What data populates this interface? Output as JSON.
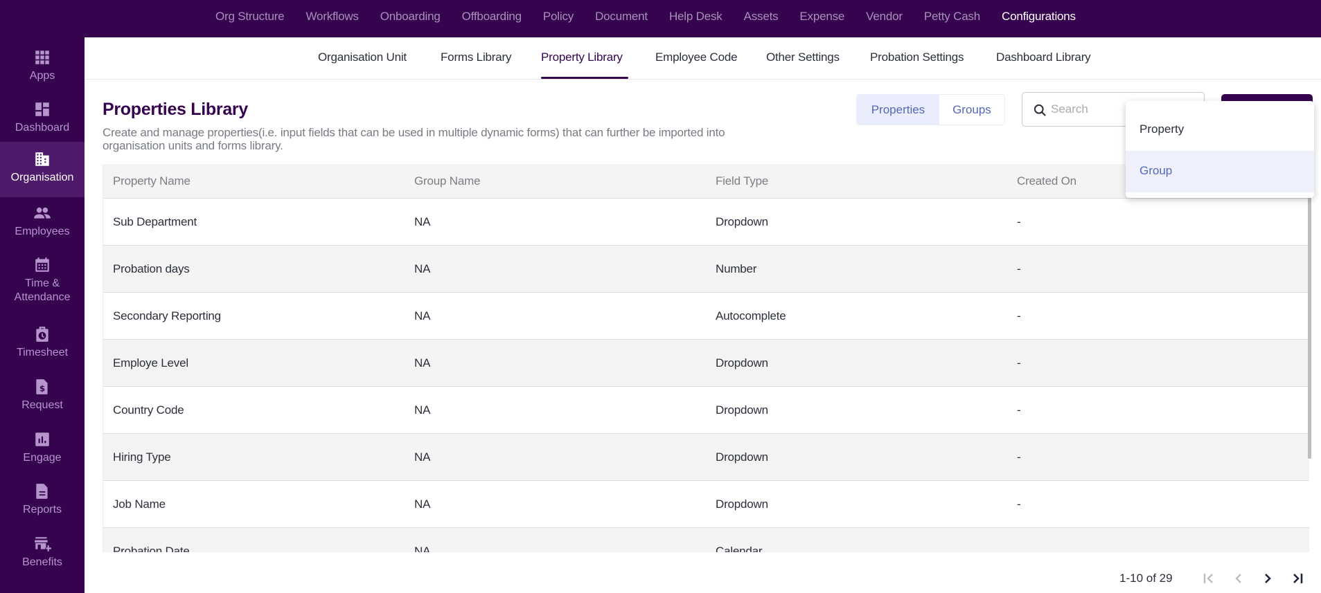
{
  "topnav": {
    "items": [
      {
        "label": "Org Structure",
        "active": false
      },
      {
        "label": "Workflows",
        "active": false
      },
      {
        "label": "Onboarding",
        "active": false
      },
      {
        "label": "Offboarding",
        "active": false
      },
      {
        "label": "Policy",
        "active": false
      },
      {
        "label": "Document",
        "active": false
      },
      {
        "label": "Help Desk",
        "active": false
      },
      {
        "label": "Assets",
        "active": false
      },
      {
        "label": "Expense",
        "active": false
      },
      {
        "label": "Vendor",
        "active": false
      },
      {
        "label": "Petty Cash",
        "active": false
      },
      {
        "label": "Configurations",
        "active": true
      }
    ]
  },
  "sidebar": {
    "items": [
      {
        "label": "Apps",
        "icon": "apps-grid-icon"
      },
      {
        "label": "Dashboard",
        "icon": "dashboard-icon"
      },
      {
        "label": "Organisation",
        "icon": "building-icon",
        "active": true
      },
      {
        "label": "Employees",
        "icon": "people-icon"
      },
      {
        "label": "Time &",
        "label2": "Attendance",
        "icon": "calendar-icon"
      },
      {
        "label": "Timesheet",
        "icon": "timesheet-clock-icon"
      },
      {
        "label": "Request",
        "icon": "dollar-document-icon"
      },
      {
        "label": "Engage",
        "icon": "bar-chart-icon"
      },
      {
        "label": "Reports",
        "icon": "report-document-icon"
      },
      {
        "label": "Benefits",
        "icon": "store-plus-icon"
      }
    ]
  },
  "subnav": {
    "items": [
      {
        "label": "Organisation Unit"
      },
      {
        "label": "Forms Library"
      },
      {
        "label": "Property Library",
        "active": true
      },
      {
        "label": "Employee Code"
      },
      {
        "label": "Other Settings"
      },
      {
        "label": "Probation Settings"
      },
      {
        "label": "Dashboard Library"
      }
    ]
  },
  "header": {
    "title": "Properties Library",
    "description": "Create and manage properties(i.e. input fields that can be used in multiple dynamic forms) that can further be imported into organisation units and forms library."
  },
  "toggle": {
    "properties_label": "Properties",
    "groups_label": "Groups",
    "selected": "Properties"
  },
  "search": {
    "placeholder": "Search",
    "value": ""
  },
  "add_menu": {
    "items": [
      {
        "label": "Property"
      },
      {
        "label": "Group",
        "highlighted": true
      }
    ]
  },
  "table": {
    "columns": [
      "Property Name",
      "Group Name",
      "Field Type",
      "Created On"
    ],
    "rows": [
      [
        "Sub Department",
        "NA",
        "Dropdown",
        "-"
      ],
      [
        "Probation days",
        "NA",
        "Number",
        "-"
      ],
      [
        "Secondary Reporting",
        "NA",
        "Autocomplete",
        "-"
      ],
      [
        "Employe Level",
        "NA",
        "Dropdown",
        "-"
      ],
      [
        "Country Code",
        "NA",
        "Dropdown",
        "-"
      ],
      [
        "Hiring Type",
        "NA",
        "Dropdown",
        "-"
      ],
      [
        "Job Name",
        "NA",
        "Dropdown",
        "-"
      ],
      [
        "Probation Date",
        "NA",
        "Calendar",
        ""
      ]
    ]
  },
  "pagination": {
    "range_text": "1-10 of 29",
    "first_enabled": false,
    "prev_enabled": false,
    "next_enabled": true,
    "last_enabled": true
  },
  "colors": {
    "brand": "#36044e",
    "accent": "#5468b8",
    "selected_bg": "#eaeefc"
  }
}
